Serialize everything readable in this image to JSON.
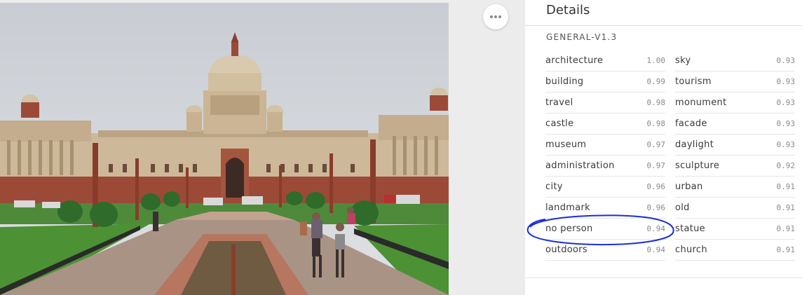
{
  "details": {
    "title": "Details",
    "model": "GENERAL-V1.3",
    "concepts_left": [
      {
        "name": "architecture",
        "value": "1.00"
      },
      {
        "name": "building",
        "value": "0.99"
      },
      {
        "name": "travel",
        "value": "0.98"
      },
      {
        "name": "castle",
        "value": "0.98"
      },
      {
        "name": "museum",
        "value": "0.97"
      },
      {
        "name": "administration",
        "value": "0.97"
      },
      {
        "name": "city",
        "value": "0.96"
      },
      {
        "name": "landmark",
        "value": "0.96"
      },
      {
        "name": "no person",
        "value": "0.94"
      },
      {
        "name": "outdoors",
        "value": "0.94"
      }
    ],
    "concepts_right": [
      {
        "name": "sky",
        "value": "0.93"
      },
      {
        "name": "tourism",
        "value": "0.93"
      },
      {
        "name": "monument",
        "value": "0.93"
      },
      {
        "name": "facade",
        "value": "0.93"
      },
      {
        "name": "daylight",
        "value": "0.93"
      },
      {
        "name": "sculpture",
        "value": "0.92"
      },
      {
        "name": "urban",
        "value": "0.91"
      },
      {
        "name": "old",
        "value": "0.91"
      },
      {
        "name": "statue",
        "value": "0.91"
      },
      {
        "name": "church",
        "value": "0.91"
      }
    ]
  },
  "colors": {
    "annotation": "#1a2fd6",
    "sandstone": "#cdb89a",
    "red_sandstone": "#9c4a38"
  },
  "icons": {
    "more": "more-horizontal-icon"
  }
}
